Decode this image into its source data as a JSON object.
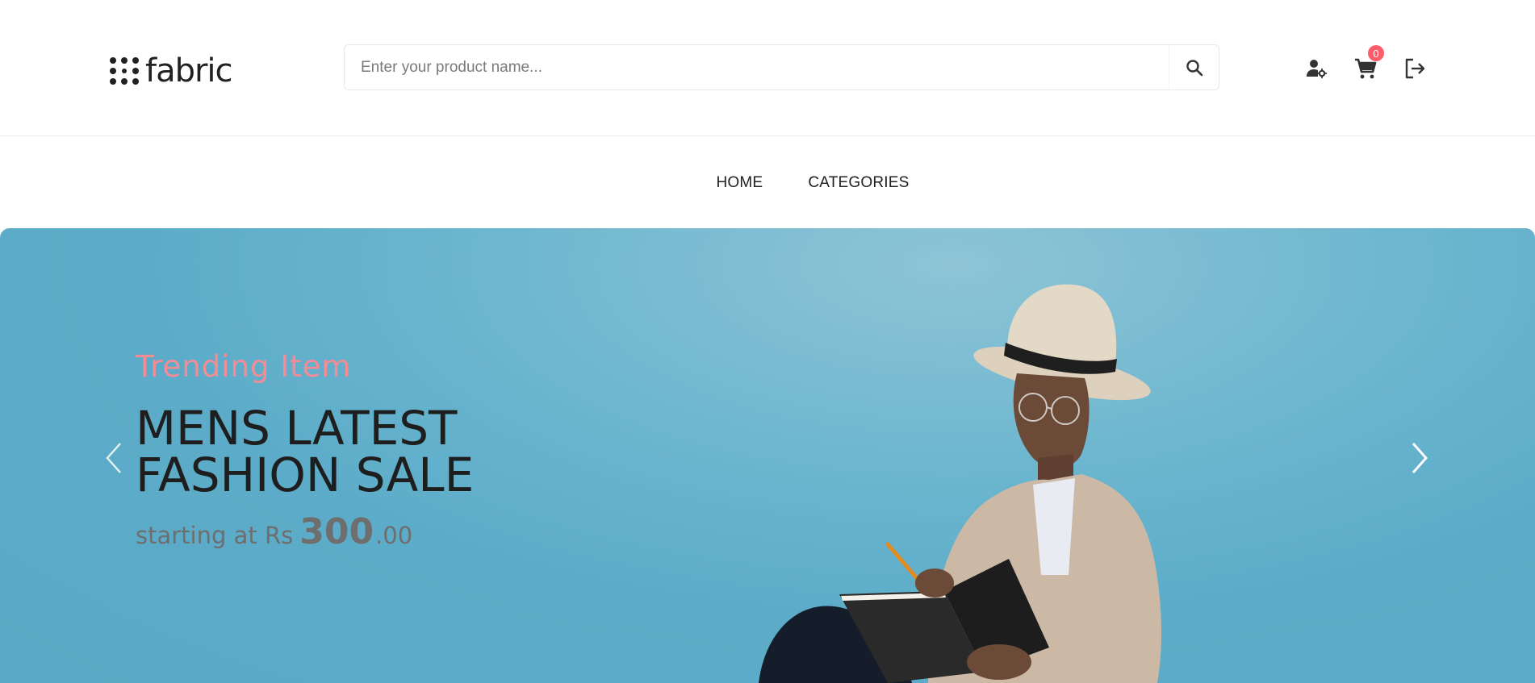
{
  "header": {
    "logo_text": "fabric",
    "search": {
      "placeholder": "Enter your product name...",
      "value": ""
    },
    "icons": [
      "user-settings-icon",
      "cart-icon",
      "logout-icon"
    ],
    "cart_count": "0"
  },
  "nav": {
    "items": [
      {
        "label": "HOME"
      },
      {
        "label": "CATEGORIES"
      }
    ]
  },
  "hero": {
    "tag": "Trending Item",
    "title_line1": "MENS LATEST",
    "title_line2": "FASHION SALE",
    "price_prefix": "starting at Rs",
    "price_main": "300",
    "price_cents": ".00"
  },
  "colors": {
    "accent_pink": "#f58c95",
    "badge": "#ff5c6b",
    "hero_bg": "#5cacc9",
    "text_dark": "#212121"
  }
}
